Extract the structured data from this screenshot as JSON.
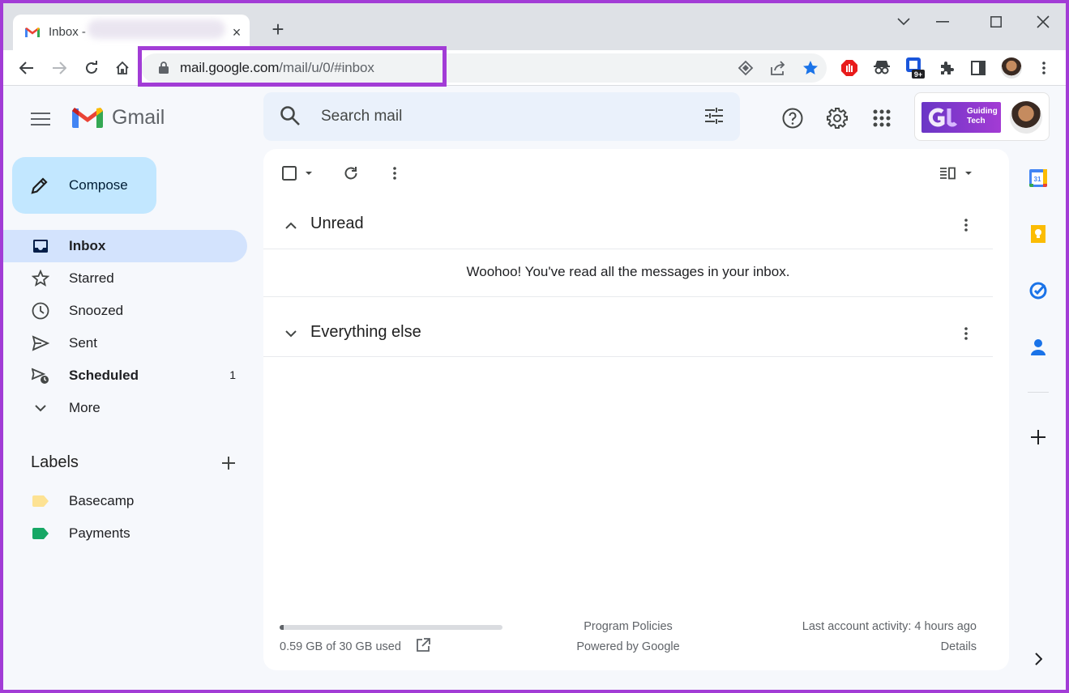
{
  "browser": {
    "tab_title": "Inbox -",
    "close_glyph": "×",
    "new_tab_glyph": "+",
    "url_host": "mail.google.com",
    "url_path": "/mail/u/0/#inbox",
    "extension_badge": "9+"
  },
  "header": {
    "app_name": "Gmail",
    "search_placeholder": "Search mail",
    "account_brand": "Guiding Tech",
    "account_brand_line1": "Guiding",
    "account_brand_line2": "Tech"
  },
  "sidebar": {
    "compose_label": "Compose",
    "items": [
      {
        "label": "Inbox",
        "icon": "inbox-icon",
        "active": true,
        "bold": true,
        "count": ""
      },
      {
        "label": "Starred",
        "icon": "star-icon",
        "active": false,
        "bold": false,
        "count": ""
      },
      {
        "label": "Snoozed",
        "icon": "clock-icon",
        "active": false,
        "bold": false,
        "count": ""
      },
      {
        "label": "Sent",
        "icon": "send-icon",
        "active": false,
        "bold": false,
        "count": ""
      },
      {
        "label": "Scheduled",
        "icon": "scheduled-send-icon",
        "active": false,
        "bold": true,
        "count": "1"
      },
      {
        "label": "More",
        "icon": "chevron-down-icon",
        "active": false,
        "bold": false,
        "count": ""
      }
    ],
    "labels_title": "Labels",
    "labels": [
      {
        "name": "Basecamp",
        "color": "#fde293"
      },
      {
        "name": "Payments",
        "color": "#16a765"
      }
    ]
  },
  "main": {
    "sections": [
      {
        "title": "Unread",
        "expanded": true
      },
      {
        "title": "Everything else",
        "expanded": false
      }
    ],
    "empty_message": "Woohoo! You've read all the messages in your inbox.",
    "footer": {
      "storage_text": "0.59 GB of 30 GB used",
      "storage_fraction": 0.0197,
      "policies": "Program Policies",
      "powered_by": "Powered by Google",
      "last_activity": "Last account activity: 4 hours ago",
      "details": "Details"
    }
  },
  "colors": {
    "highlight": "#a23cd6",
    "active_nav": "#d3e3fd",
    "compose_bg": "#c2e7ff",
    "search_bg": "#eaf1fb"
  }
}
